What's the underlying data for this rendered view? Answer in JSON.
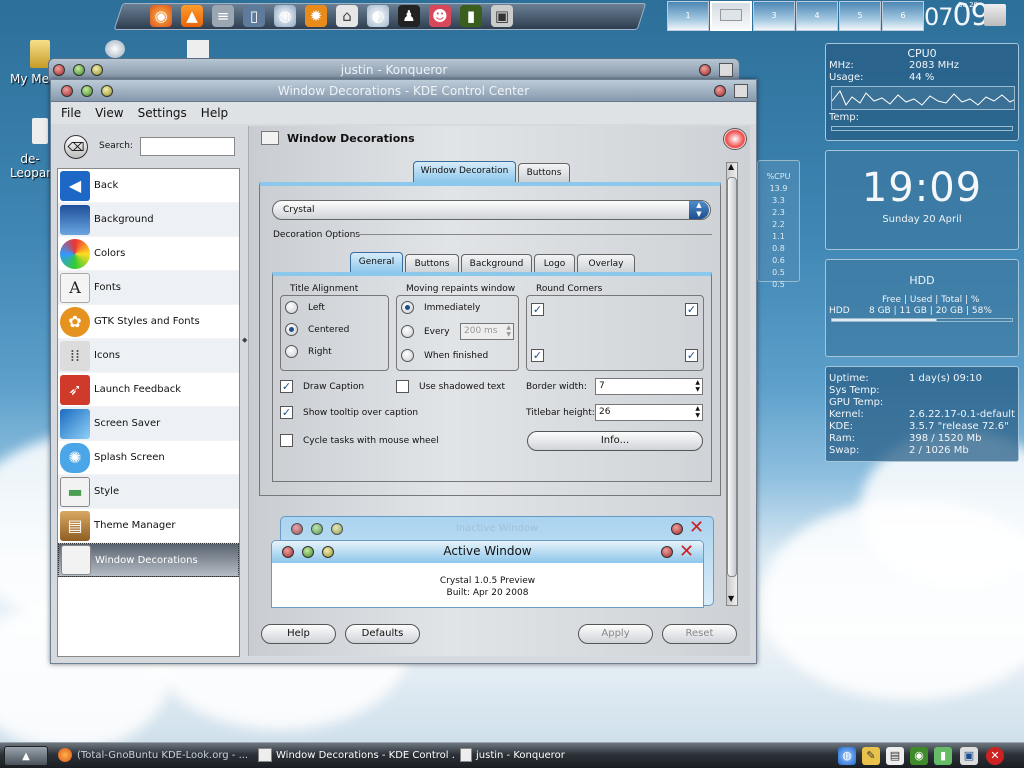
{
  "top_dock": {
    "icons": [
      "firefox-icon",
      "vlc-icon",
      "mixer-icon",
      "phone-icon",
      "globe-icon",
      "gear-icon",
      "home-icon",
      "disk-icon",
      "tux-icon",
      "robot-icon",
      "bottle-icon",
      "camera-icon"
    ]
  },
  "pager": {
    "desktops": [
      "1",
      "2",
      "3",
      "4",
      "5",
      "6"
    ],
    "current": "2"
  },
  "top_clock": {
    "hours": "07",
    "minutes": "09",
    "small_date": "Su 20"
  },
  "desktop_icons": [
    {
      "label": "My Me"
    },
    {
      "label": "de-Leopar"
    }
  ],
  "konqueror_window": {
    "title": "justin - Konqueror"
  },
  "window": {
    "title": "Window Decorations - KDE Control Center"
  },
  "menu": [
    "File",
    "View",
    "Settings",
    "Help"
  ],
  "search": {
    "label": "Search:",
    "value": ""
  },
  "sidebar": {
    "items": [
      {
        "label": "Back",
        "icon": "back-arrow-icon",
        "color": "#1d67c7"
      },
      {
        "label": "Background",
        "icon": "background-icon",
        "color": "#2f75c5"
      },
      {
        "label": "Colors",
        "icon": "colors-icon",
        "color": "#e8a22b"
      },
      {
        "label": "Fonts",
        "icon": "fonts-icon",
        "color": "#f4f4f4"
      },
      {
        "label": "GTK Styles and Fonts",
        "icon": "gtk-icon",
        "color": "#e6921e"
      },
      {
        "label": "Icons",
        "icon": "icons-icon",
        "color": "#c9c9c9"
      },
      {
        "label": "Launch Feedback",
        "icon": "rocket-icon",
        "color": "#cf3a2a"
      },
      {
        "label": "Screen Saver",
        "icon": "screensaver-icon",
        "color": "#3d90d6"
      },
      {
        "label": "Splash Screen",
        "icon": "splash-icon",
        "color": "#4aa6e8"
      },
      {
        "label": "Style",
        "icon": "style-icon",
        "color": "#4aa052"
      },
      {
        "label": "Theme Manager",
        "icon": "theme-icon",
        "color": "#b07c3e"
      },
      {
        "label": "Window Decorations",
        "icon": "window-icon",
        "color": "#f2f2f2"
      }
    ],
    "selected": "Window Decorations"
  },
  "panel": {
    "title": "Window Decorations"
  },
  "outer_tabs": [
    {
      "label": "Window Decoration",
      "active": true
    },
    {
      "label": "Buttons",
      "active": false
    }
  ],
  "decoration_combo": {
    "value": "Crystal"
  },
  "decoration_options_label": "Decoration Options",
  "inner_tabs": [
    {
      "label": "General",
      "active": true
    },
    {
      "label": "Buttons"
    },
    {
      "label": "Background"
    },
    {
      "label": "Logo"
    },
    {
      "label": "Overlay"
    }
  ],
  "title_alignment": {
    "label": "Title Alignment",
    "options": [
      "Left",
      "Centered",
      "Right"
    ],
    "selected": "Centered"
  },
  "repaint": {
    "label": "Moving repaints window",
    "options": [
      "Immediately",
      "Every",
      "When finished"
    ],
    "selected": "Immediately",
    "every_value": "200 ms"
  },
  "round_corners": {
    "label": "Round Corners"
  },
  "checks": {
    "draw_caption": "Draw Caption",
    "shadowed": "Use shadowed text",
    "tooltip": "Show tooltip over caption",
    "cycle": "Cycle tasks with mouse wheel"
  },
  "border_width": {
    "label": "Border width:",
    "value": "7"
  },
  "titlebar_height": {
    "label": "Titlebar height:",
    "value": "26"
  },
  "info_button": "Info...",
  "preview": {
    "inactive_title": "Inactive Window",
    "active_title": "Active Window",
    "line1": "Crystal 1.0.5 Preview",
    "line2": "Built: Apr 20 2008"
  },
  "buttons": {
    "help": "Help",
    "defaults": "Defaults",
    "apply": "Apply",
    "reset": "Reset"
  },
  "cpu_bg": {
    "title": "%CPU",
    "values": [
      "13.9",
      "3.3",
      "2.3",
      "2.2",
      "1.1",
      "0.8",
      "0.6",
      "0.5",
      "0.5"
    ]
  },
  "cpu_widget": {
    "title": "CPU0",
    "mhz_label": "MHz:",
    "mhz": "2083 MHz",
    "usage_label": "Usage:",
    "usage": "44 %",
    "temp_label": "Temp:"
  },
  "clock_widget": {
    "time": "19:09",
    "date": "Sunday 20 April"
  },
  "hdd_widget": {
    "title": "HDD",
    "header": "Free  |  Used  |  Total  |  %",
    "row_label": "HDD",
    "row": "8 GB | 11 GB | 20 GB | 58%"
  },
  "sys_widget": {
    "rows": [
      {
        "k": "Uptime:",
        "v": "1 day(s)  09:10"
      },
      {
        "k": "Sys Temp:",
        "v": ""
      },
      {
        "k": "GPU Temp:",
        "v": ""
      },
      {
        "k": "Kernel:",
        "v": "2.6.22.17-0.1-default"
      },
      {
        "k": "KDE:",
        "v": "3.5.7 \"release 72.6\""
      },
      {
        "k": "Ram:",
        "v": "398 / 1520 Mb"
      },
      {
        "k": "Swap:",
        "v": "2 / 1026 Mb"
      }
    ]
  },
  "taskbar": {
    "tasks": [
      "(Total-GnoBuntu KDE-Look.org - ...",
      "Window Decorations - KDE Control ...",
      "justin - Konqueror"
    ]
  }
}
